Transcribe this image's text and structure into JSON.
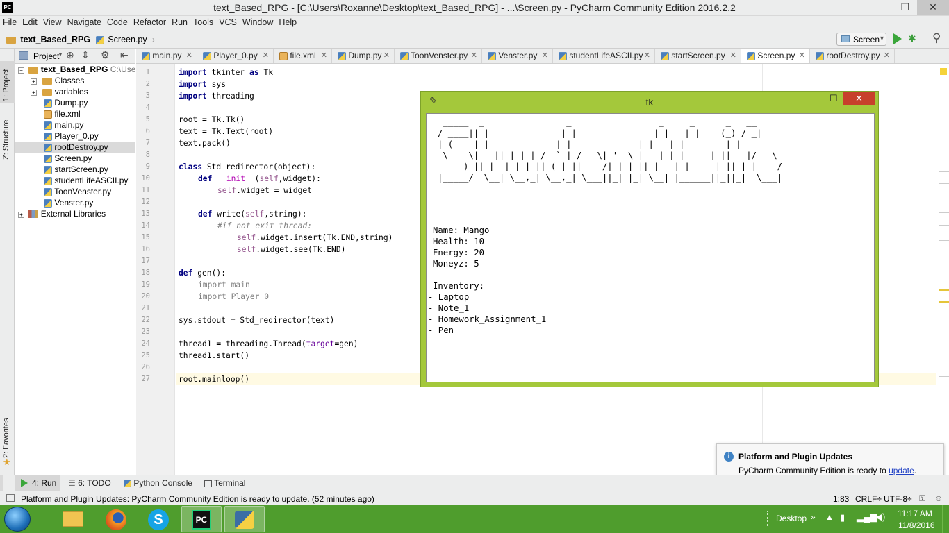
{
  "window": {
    "title": "text_Based_RPG - [C:\\Users\\Roxanne\\Desktop\\text_Based_RPG] - ...\\Screen.py - PyCharm Community Edition 2016.2.2",
    "app_icon": "PC",
    "min": "—",
    "max": "❐",
    "close": "✕"
  },
  "menu": [
    "File",
    "Edit",
    "View",
    "Navigate",
    "Code",
    "Refactor",
    "Run",
    "Tools",
    "VCS",
    "Window",
    "Help"
  ],
  "nav": {
    "project": "text_Based_RPG",
    "file": "Screen.py",
    "run_config": "Screen"
  },
  "side_labels": {
    "project": "1: Project",
    "structure": "Z: Structure",
    "favorites": "2: Favorites"
  },
  "project_panel": {
    "title": "Project",
    "root": "text_Based_RPG",
    "root_path": "C:\\Use",
    "items": [
      "Classes",
      "variables",
      "Dump.py",
      "file.xml",
      "main.py",
      "Player_0.py",
      "rootDestroy.py",
      "Screen.py",
      "startScreen.py",
      "studentLifeASCII.py",
      "ToonVenster.py",
      "Venster.py"
    ],
    "external": "External Libraries"
  },
  "tabs": [
    "main.py",
    "Player_0.py",
    "file.xml",
    "Dump.py",
    "ToonVenster.py",
    "Venster.py",
    "studentLifeASCII.py",
    "startScreen.py",
    "Screen.py",
    "rootDestroy.py"
  ],
  "line_numbers": [
    "1",
    "2",
    "3",
    "4",
    "5",
    "6",
    "7",
    "8",
    "9",
    "10",
    "11",
    "12",
    "13",
    "14",
    "15",
    "16",
    "17",
    "18",
    "19",
    "20",
    "21",
    "22",
    "23",
    "24",
    "25",
    "26",
    "27"
  ],
  "code": {
    "l1a": "import",
    "l1b": " tkinter ",
    "l1c": "as",
    "l1d": " Tk",
    "l2a": "import",
    "l2b": " sys",
    "l3a": "import",
    "l3b": " threading",
    "l5": "root = Tk.Tk()",
    "l6": "text = Tk.Text(root)",
    "l7": "text.pack()",
    "l9a": "class",
    "l9b": " Std_redirector(object):",
    "l10a": "def",
    "l10b": "__init__",
    "l10c": "(",
    "l10d": "self",
    "l10e": ",widget):",
    "l11a": "self",
    "l11b": ".widget = widget",
    "l13a": "def",
    "l13b": " write(",
    "l13c": "self",
    "l13d": ",string):",
    "l14": "#if not exit_thread:",
    "l15a": "self",
    "l15b": ".widget.insert(Tk.END,string)",
    "l16a": "self",
    "l16b": ".widget.see(Tk.END)",
    "l18a": "def",
    "l18b": " gen():",
    "l19": "import main",
    "l20": "import Player_0",
    "l22": "sys.stdout = Std_redirector(text)",
    "l24a": "thread1 = threading.Thread(",
    "l24b": "target",
    "l24c": "=gen)",
    "l25": "thread1.start()",
    "l27": "root.mainloop()"
  },
  "tk_window": {
    "title": "tk",
    "ascii_art": " _____  _                _                 _     _      _   __\n/ ____|| |              | |               | |   | |    (_) / _|\n| (___ | |_  _   _   __| |  ___  _ __  | |_  | |      _ | |_  ___\n \\___ \\| __|| | | | / _` | / _ \\| '_ \\ | __| | |     | ||  _|/ _ \\\n ____) || |_ | |_| || (_| ||  __/| | | || |_  | |____ | || | |  __/\n|_____/  \\__| \\__,_| \\__,_| \\___||_| |_| \\__| |______||_||_|  \\___|",
    "name": "Name: Mango",
    "health": "Health: 10",
    "energy": "Energy: 20",
    "moneyz": "Moneyz: 5",
    "inventory": "Inventory:",
    "items": [
      "- Laptop",
      "- Note_1",
      "- Homework_Assignment_1",
      "- Pen"
    ]
  },
  "tool_windows": {
    "run": "4: Run",
    "todo": "6: TODO",
    "console": "Python Console",
    "terminal": "Terminal"
  },
  "status": {
    "message": "Platform and Plugin Updates: PyCharm Community Edition is ready to update. (52 minutes ago)",
    "position": "1:83",
    "line_sep": "CRLF÷",
    "encoding": "UTF-8÷"
  },
  "notification": {
    "title": "Platform and Plugin Updates",
    "body": "PyCharm Community Edition is ready to ",
    "link": "update",
    "period": "."
  },
  "taskbar": {
    "desktop": "Desktop",
    "time": "11:17 AM",
    "date": "11/8/2016"
  },
  "colors": {
    "tk_frame": "#a4c83b",
    "taskbar": "#4f9d2d",
    "keyword": "#000080",
    "self": "#94558d"
  }
}
